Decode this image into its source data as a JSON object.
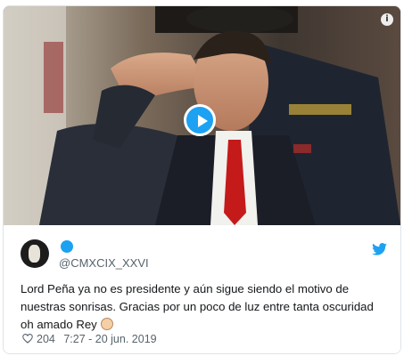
{
  "tweet": {
    "handle": "@CMXCIX_XXVI",
    "text": "Lord Peña ya no es presidente y aún sigue siendo el motivo de nuestras sonrisas. Gracias por un poco de luz entre tanta oscuridad oh amado Rey",
    "likes": "204",
    "timestamp": "7:27 - 20 jun. 2019"
  },
  "colors": {
    "accent": "#1da1f2",
    "text": "#14171a",
    "muted": "#57636c"
  },
  "icons": {
    "info": "i",
    "play": "play-icon",
    "twitter": "twitter-bird-icon",
    "like": "heart-icon"
  }
}
